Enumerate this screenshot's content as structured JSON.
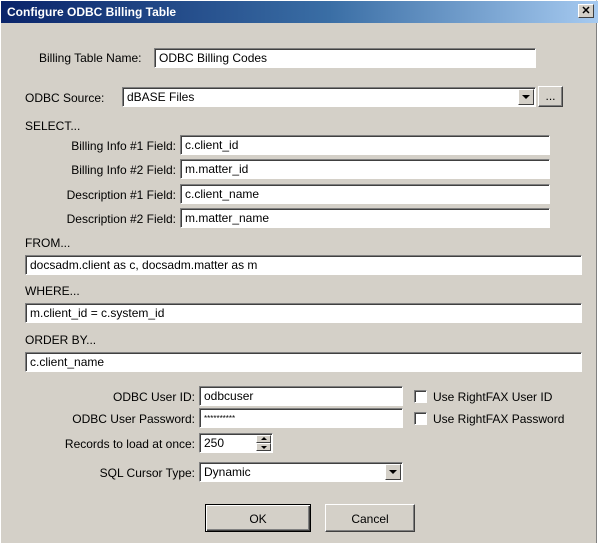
{
  "window": {
    "title": "Configure ODBC Billing Table",
    "close_glyph": "✕"
  },
  "billing_table_name": {
    "label": "Billing Table Name:",
    "value": "ODBC Billing Codes"
  },
  "odbc_source": {
    "label": "ODBC Source:",
    "value": "dBASE Files",
    "browse_label": "..."
  },
  "select": {
    "heading": "SELECT...",
    "fields": [
      {
        "label": "Billing Info #1 Field:",
        "value": "c.client_id"
      },
      {
        "label": "Billing Info #2 Field:",
        "value": "m.matter_id"
      },
      {
        "label": "Description #1 Field:",
        "value": "c.client_name"
      },
      {
        "label": "Description #2 Field:",
        "value": "m.matter_name"
      }
    ]
  },
  "from": {
    "heading": "FROM...",
    "value": "docsadm.client as c, docsadm.matter as m"
  },
  "where": {
    "heading": "WHERE...",
    "value": "m.client_id = c.system_id"
  },
  "order_by": {
    "heading": "ORDER BY...",
    "value": "c.client_name"
  },
  "odbc_user_id": {
    "label": "ODBC User ID:",
    "value": "odbcuser",
    "checkbox_label": "Use RightFAX User ID",
    "checked": false
  },
  "odbc_user_password": {
    "label": "ODBC User Password:",
    "value": "**********",
    "checkbox_label": "Use RightFAX Password",
    "checked": false
  },
  "records_to_load": {
    "label": "Records to load at once:",
    "value": "250"
  },
  "sql_cursor_type": {
    "label": "SQL Cursor Type:",
    "value": "Dynamic"
  },
  "buttons": {
    "ok": "OK",
    "cancel": "Cancel"
  }
}
